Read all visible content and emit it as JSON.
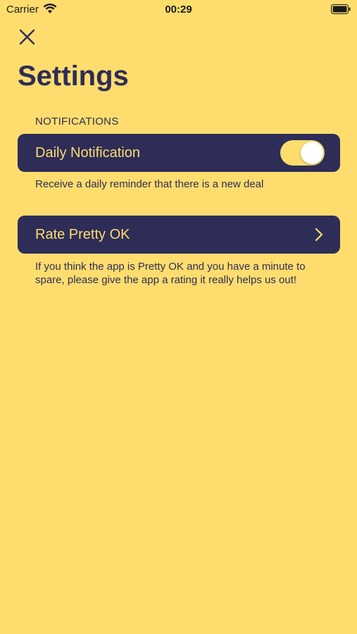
{
  "status_bar": {
    "carrier": "Carrier",
    "time": "00:29",
    "wifi_icon": "wifi-icon",
    "battery_icon": "battery-icon"
  },
  "nav": {
    "close_icon": "close-icon"
  },
  "title": "Settings",
  "sections": {
    "notifications": {
      "header": "NOTIFICATIONS",
      "daily_notification": {
        "label": "Daily Notification",
        "toggle_on": true,
        "description": "Receive a daily reminder that there is a new deal"
      }
    },
    "rate": {
      "label": "Rate Pretty OK",
      "chevron_icon": "chevron-right-icon",
      "description": "If you think the app is Pretty OK and you have a minute to spare, please give the app a rating it really helps us out!"
    }
  },
  "colors": {
    "background": "#FEDD6E",
    "accent": "#2E2D57",
    "toggle_track": "#FEDD6E",
    "toggle_knob": "#FFFFFF"
  }
}
